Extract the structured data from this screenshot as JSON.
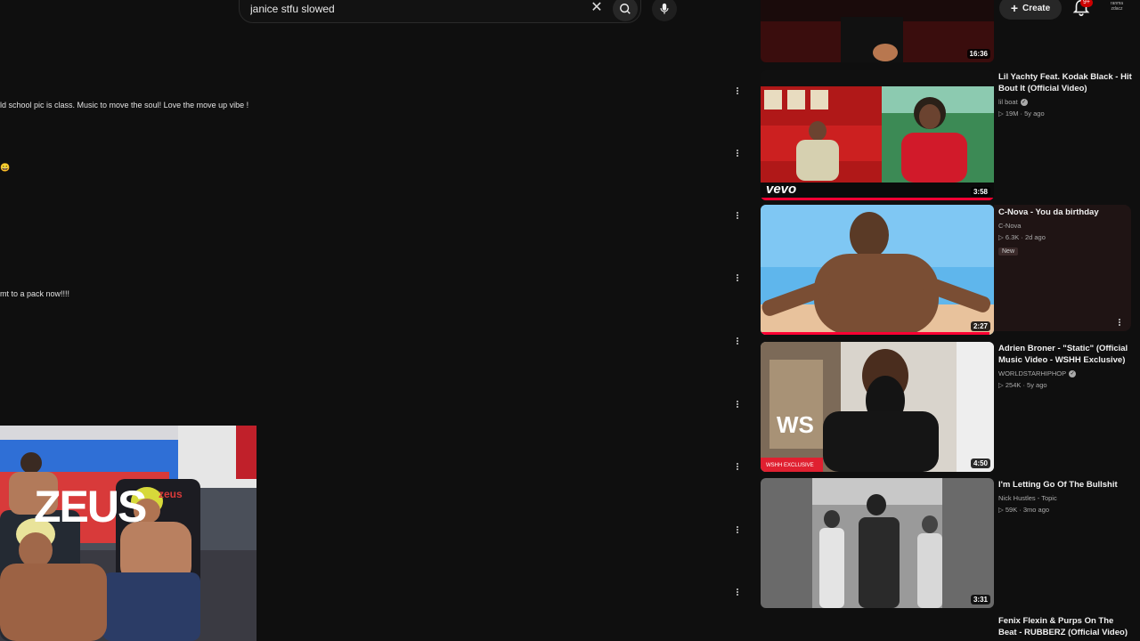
{
  "search": {
    "query": "janice stfu slowed"
  },
  "header": {
    "create_label": "Create",
    "notification_count": "9+",
    "account_label": "ranma zdacz"
  },
  "comments": [
    {
      "text": "ld school pic is class.  Music to move the soul!  Love the move up vibe !"
    },
    {
      "text": "😀"
    },
    {
      "text": "mt to a pack now!!!!"
    }
  ],
  "sidebar": {
    "videos": [
      {
        "title": "",
        "channel": "",
        "meta": "",
        "duration": "16:36"
      },
      {
        "title": "Lil Yachty Feat. Kodak Black - Hit Bout It (Official Video)",
        "channel": "lil boat",
        "meta": "19M · 5y ago",
        "duration": "3:58",
        "logo": "vevo",
        "watched": 1.0
      },
      {
        "title": "C-Nova - You da birthday",
        "channel": "C-Nova",
        "meta": "6.3K · 2d ago",
        "badge": "New",
        "duration": "2:27",
        "watched": 0.95
      },
      {
        "title": "Adrien Broner - \"Static\" (Official Music Video - WSHH Exclusive)",
        "channel": "WORLDSTARHIPHOP",
        "meta": "254K · 5y ago",
        "duration": "4:50",
        "exclusive": "WSHH EXCLUSIVE"
      },
      {
        "title": "I'm Letting Go Of The Bullshit",
        "channel": "Nick Hustles - Topic",
        "meta": "59K · 3mo ago",
        "duration": "3:31"
      },
      {
        "title": "Fenix Flexin & Purps On The Beat - RUBBERZ (Official Video)",
        "channel": "",
        "meta": "",
        "duration": ""
      }
    ]
  },
  "webcam": {
    "banner_text": "ZEUS",
    "chair_text": "zeus"
  },
  "colors": {
    "background": "#0f0f0f",
    "accent": "#ff0033",
    "text": "#f1f1f1",
    "muted": "#aaaaaa"
  }
}
